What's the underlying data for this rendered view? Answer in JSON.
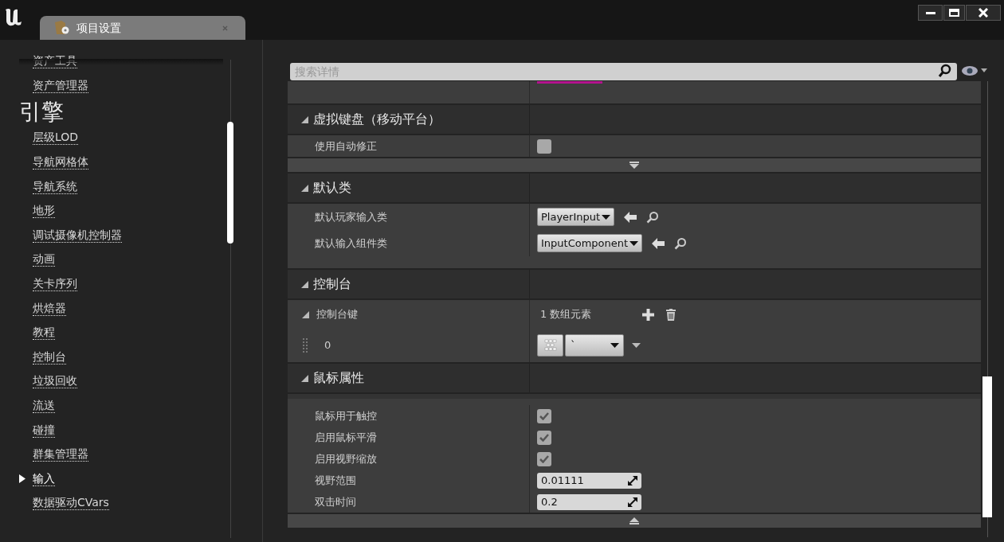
{
  "window": {
    "tab": {
      "title": "项目设置"
    }
  },
  "sidebar": {
    "items_above": [
      {
        "label": "资产工具",
        "selected": false
      },
      {
        "label": "资产管理器",
        "selected": false
      }
    ],
    "section_title": "引擎",
    "items": [
      {
        "label": "层级LOD",
        "selected": false
      },
      {
        "label": "导航网格体",
        "selected": false
      },
      {
        "label": "导航系统",
        "selected": false
      },
      {
        "label": "地形",
        "selected": false
      },
      {
        "label": "调试摄像机控制器",
        "selected": false
      },
      {
        "label": "动画",
        "selected": false
      },
      {
        "label": "关卡序列",
        "selected": false
      },
      {
        "label": "烘焙器",
        "selected": false
      },
      {
        "label": "教程",
        "selected": false
      },
      {
        "label": "控制台",
        "selected": false
      },
      {
        "label": "垃圾回收",
        "selected": false
      },
      {
        "label": "流送",
        "selected": false
      },
      {
        "label": "碰撞",
        "selected": false
      },
      {
        "label": "群集管理器",
        "selected": false
      },
      {
        "label": "输入",
        "selected": true
      },
      {
        "label": "数据驱动CVars",
        "selected": false
      }
    ]
  },
  "details": {
    "search": {
      "placeholder": "搜索详情"
    },
    "partial_row": {
      "kind": "color",
      "color": "#b3138e"
    },
    "sections": [
      {
        "title": "虚拟键盘（移动平台）",
        "expanded": true,
        "advanced_open": false,
        "rows": [
          {
            "kind": "checkbox",
            "label": "使用自动修正",
            "checked": false
          }
        ]
      },
      {
        "title": "默认类",
        "expanded": true,
        "rows": [
          {
            "kind": "class",
            "label": "默认玩家输入类",
            "value": "PlayerInput"
          },
          {
            "kind": "class",
            "label": "默认输入组件类",
            "value": "InputComponent"
          }
        ]
      },
      {
        "title": "控制台",
        "expanded": true,
        "rows": [
          {
            "kind": "array",
            "label": "控制台键",
            "count": "1 数组元素",
            "expanded": true,
            "children": [
              {
                "kind": "key",
                "label": "0",
                "value": "`"
              }
            ]
          }
        ]
      },
      {
        "title": "鼠标属性",
        "expanded": true,
        "advanced_open": true,
        "rows": [
          {
            "kind": "checkbox",
            "label": "鼠标用于触控",
            "checked": true
          },
          {
            "kind": "checkbox",
            "label": "启用鼠标平滑",
            "checked": true
          },
          {
            "kind": "checkbox",
            "label": "启用视野缩放",
            "checked": true
          },
          {
            "kind": "number",
            "label": "视野范围",
            "value": "0.01111"
          },
          {
            "kind": "number",
            "label": "双击时间",
            "value": "0.2"
          }
        ]
      }
    ]
  }
}
